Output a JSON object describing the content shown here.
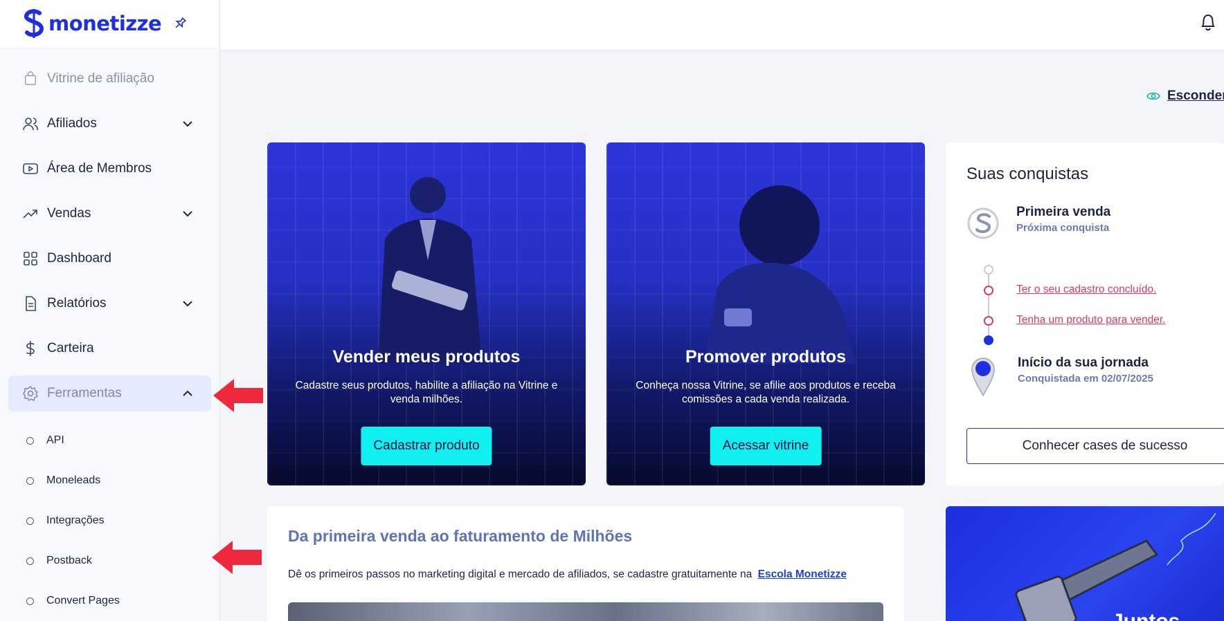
{
  "brand": {
    "name": "monetizze",
    "color": "#1f2ee0"
  },
  "sidebar": {
    "items": [
      {
        "label": "Vitrine de afiliação",
        "icon": "shopping-bag-icon",
        "state": "muted"
      },
      {
        "label": "Afiliados",
        "icon": "users-icon",
        "expandable": true
      },
      {
        "label": "Área de Membros",
        "icon": "play-icon"
      },
      {
        "label": "Vendas",
        "icon": "trending-up-icon",
        "expandable": true
      },
      {
        "label": "Dashboard",
        "icon": "grid-icon"
      },
      {
        "label": "Relatórios",
        "icon": "document-icon",
        "expandable": true
      },
      {
        "label": "Carteira",
        "icon": "dollar-icon"
      },
      {
        "label": "Ferramentas",
        "icon": "gear-icon",
        "expandable": true,
        "expanded": true,
        "active": true
      }
    ],
    "sub_items": [
      "API",
      "Moneleads",
      "Integrações",
      "Postback",
      "Convert Pages"
    ]
  },
  "header": {
    "hide_link": "Esconder v"
  },
  "cards": {
    "sell": {
      "title": "Vender meus produtos",
      "desc": "Cadastre seus produtos, habilite a afiliação na Vitrine e venda milhões.",
      "cta": "Cadastrar produto"
    },
    "promote": {
      "title": "Promover produtos",
      "desc": "Conheça nossa Vitrine, se afilie aos produtos e receba comissões a cada venda realizada.",
      "cta": "Acessar vitrine"
    }
  },
  "achievements": {
    "title": "Suas conquistas",
    "next": {
      "name": "Primeira venda",
      "status": "Próxima conquista"
    },
    "tasks": [
      "Ter o seu cadastro concluído.",
      "Tenha um produto para vender."
    ],
    "done": {
      "name": "Início da sua jornada",
      "status": "Conquistada em 02/07/2025"
    },
    "cta": "Conhecer cases de sucesso"
  },
  "info": {
    "title": "Da primeira venda ao faturamento de Milhões",
    "text": "Dê os primeiros passos no marketing digital e mercado de afiliados, se cadastre gratuitamente na",
    "link": "Escola Monetizze"
  },
  "promo": {
    "text": "Juntos"
  },
  "colors": {
    "accent_cyan": "#10f0f0",
    "active_bg": "#e6eaff",
    "task_red": "#e2395a",
    "annotation_arrow": "#f0283c"
  }
}
